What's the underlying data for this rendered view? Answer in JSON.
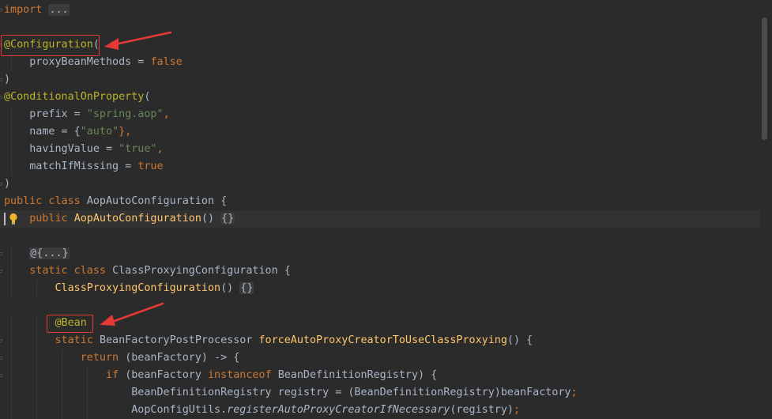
{
  "editor": {
    "lines": [
      {
        "tokens": [
          {
            "t": "import",
            "c": "kw"
          },
          {
            "t": " ",
            "c": "plain"
          },
          {
            "t": "...",
            "c": "fold-box"
          }
        ]
      },
      {
        "tokens": []
      },
      {
        "tokens": [
          {
            "t": "@Configuration",
            "c": "ann"
          },
          {
            "t": "(",
            "c": "plain"
          }
        ]
      },
      {
        "tokens": [
          {
            "t": "    proxyBeanMethods = ",
            "c": "plain"
          },
          {
            "t": "false",
            "c": "kw"
          }
        ]
      },
      {
        "tokens": [
          {
            "t": ")",
            "c": "plain"
          }
        ]
      },
      {
        "tokens": [
          {
            "t": "@ConditionalOnProperty",
            "c": "ann"
          },
          {
            "t": "(",
            "c": "plain"
          }
        ]
      },
      {
        "tokens": [
          {
            "t": "    prefix = ",
            "c": "plain"
          },
          {
            "t": "\"spring.aop\"",
            "c": "str"
          },
          {
            "t": ",",
            "c": "kw"
          }
        ]
      },
      {
        "tokens": [
          {
            "t": "    name = {",
            "c": "plain"
          },
          {
            "t": "\"auto\"",
            "c": "str"
          },
          {
            "t": "},",
            "c": "kw"
          }
        ]
      },
      {
        "tokens": [
          {
            "t": "    havingValue = ",
            "c": "plain"
          },
          {
            "t": "\"true\"",
            "c": "str"
          },
          {
            "t": ",",
            "c": "kw"
          }
        ]
      },
      {
        "tokens": [
          {
            "t": "    matchIfMissing = ",
            "c": "plain"
          },
          {
            "t": "true",
            "c": "kw"
          }
        ]
      },
      {
        "tokens": [
          {
            "t": ")",
            "c": "plain"
          }
        ]
      },
      {
        "tokens": [
          {
            "t": "public class ",
            "c": "kw"
          },
          {
            "t": "AopAutoConfiguration {",
            "c": "plain"
          }
        ]
      },
      {
        "tokens": [
          {
            "t": "    ",
            "c": "plain"
          },
          {
            "t": "public ",
            "c": "kw"
          },
          {
            "t": "AopAutoConfiguration",
            "c": "fn"
          },
          {
            "t": "() ",
            "c": "plain"
          },
          {
            "t": "{}",
            "c": "fold-box"
          }
        ]
      },
      {
        "tokens": []
      },
      {
        "tokens": [
          {
            "t": "    ",
            "c": "plain"
          },
          {
            "t": "@{...}",
            "c": "fold-box"
          }
        ]
      },
      {
        "tokens": [
          {
            "t": "    ",
            "c": "plain"
          },
          {
            "t": "static class ",
            "c": "kw"
          },
          {
            "t": "ClassProxyingConfiguration {",
            "c": "plain"
          }
        ]
      },
      {
        "tokens": [
          {
            "t": "        ",
            "c": "plain"
          },
          {
            "t": "ClassProxyingConfiguration",
            "c": "fn"
          },
          {
            "t": "() ",
            "c": "plain"
          },
          {
            "t": "{}",
            "c": "fold-box"
          }
        ]
      },
      {
        "tokens": []
      },
      {
        "tokens": [
          {
            "t": "        ",
            "c": "plain"
          },
          {
            "t": "@Bean",
            "c": "ann"
          }
        ]
      },
      {
        "tokens": [
          {
            "t": "        ",
            "c": "plain"
          },
          {
            "t": "static ",
            "c": "kw"
          },
          {
            "t": "BeanFactoryPostProcessor ",
            "c": "plain"
          },
          {
            "t": "forceAutoProxyCreatorToUseClassProxying",
            "c": "fn"
          },
          {
            "t": "() {",
            "c": "plain"
          }
        ]
      },
      {
        "tokens": [
          {
            "t": "            ",
            "c": "plain"
          },
          {
            "t": "return ",
            "c": "kw"
          },
          {
            "t": "(beanFactory) -> {",
            "c": "plain"
          }
        ]
      },
      {
        "tokens": [
          {
            "t": "                ",
            "c": "plain"
          },
          {
            "t": "if ",
            "c": "kw"
          },
          {
            "t": "(beanFactory ",
            "c": "plain"
          },
          {
            "t": "instanceof ",
            "c": "kw"
          },
          {
            "t": "BeanDefinitionRegistry) {",
            "c": "plain"
          }
        ]
      },
      {
        "tokens": [
          {
            "t": "                    BeanDefinitionRegistry registry = (BeanDefinitionRegistry)beanFactory",
            "c": "plain"
          },
          {
            "t": ";",
            "c": "kw"
          }
        ]
      },
      {
        "tokens": [
          {
            "t": "                    AopConfigUtils.",
            "c": "plain"
          },
          {
            "t": "registerAutoProxyCreatorIfNecessary",
            "c": "italic"
          },
          {
            "t": "(registry)",
            "c": "plain"
          },
          {
            "t": ";",
            "c": "kw"
          }
        ]
      }
    ]
  }
}
